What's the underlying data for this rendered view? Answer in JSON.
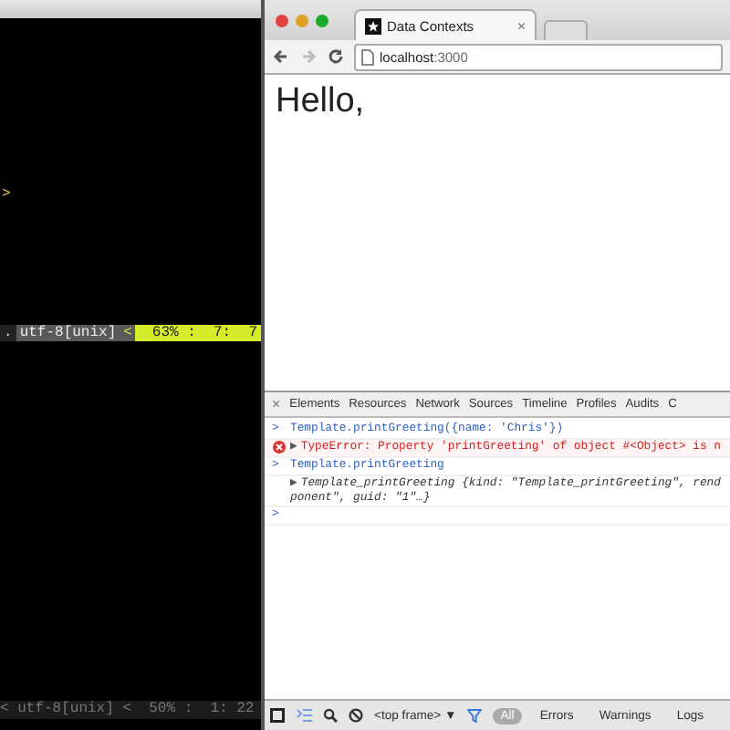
{
  "terminal": {
    "lines": [
      ">"
    ],
    "status_upper": [
      {
        "kind": "plain",
        "text": "."
      },
      {
        "kind": "encoding",
        "text": "utf-8[unix]"
      },
      {
        "kind": "separator",
        "text": "<"
      },
      {
        "kind": "position",
        "text": "63% :  7:  7"
      }
    ],
    "status_lower": "< utf-8[unix] <  50% :  1: 22"
  },
  "browser": {
    "tabs": [
      {
        "title": "Data Contexts",
        "close": "×",
        "selected": true
      }
    ],
    "url": "**localhost**:3000",
    "page": {
      "heading": "Hello,"
    },
    "devtools": {
      "close": "×",
      "tabs": [
        {
          "label": "Elements",
          "selected": false
        },
        {
          "label": "Resources",
          "selected": false
        },
        {
          "label": "Network",
          "selected": false
        },
        {
          "label": "Sources",
          "selected": false
        },
        {
          "label": "Timeline",
          "selected": false
        },
        {
          "label": "Profiles",
          "selected": false
        },
        {
          "label": "Audits",
          "selected": false
        },
        {
          "label": "C",
          "selected": false
        }
      ],
      "console": [
        {
          "kind": "input",
          "prompt": ">",
          "text": "Template.printGreeting({name: 'Chris'})"
        },
        {
          "kind": "error",
          "expander": "▶",
          "text": "TypeError: Property 'printGreeting' of object #<Object> is n"
        },
        {
          "kind": "input",
          "prompt": ">",
          "text": "Template.printGreeting"
        },
        {
          "kind": "object",
          "expander": "▶",
          "text": "Template_printGreeting {kind: \"Template_printGreeting\", rend",
          "continuation": "ponent\", guid: \"1\"…}"
        },
        {
          "kind": "prompt",
          "prompt": ">"
        }
      ],
      "frame_selector": {
        "label": "<top frame>",
        "caret": "▼"
      },
      "filters": [
        {
          "label": "All",
          "selected": true
        },
        {
          "label": "Errors",
          "selected": false
        },
        {
          "label": "Warnings",
          "selected": false
        },
        {
          "label": "Logs",
          "selected": false
        }
      ]
    }
  }
}
